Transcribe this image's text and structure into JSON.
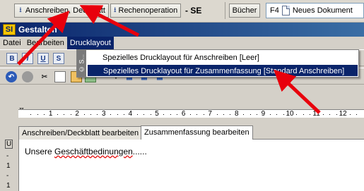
{
  "taskbar": {
    "btn_anschreiben": "Anschreiben, Deckblatt",
    "btn_rechenoperation": "Rechenoperation",
    "se_label": "- SE",
    "btn_buecher": "Bücher",
    "doc_hotkey": "F4",
    "doc_label": "Neues Dokument"
  },
  "window": {
    "logo": "SI",
    "title": "Gestalten"
  },
  "menubar": {
    "datei": "Datei",
    "bearbeiten": "Bearbeiten",
    "drucklayout": "Drucklayout"
  },
  "format_buttons": [
    "B",
    "I",
    "U",
    "S"
  ],
  "dropdown": {
    "side_label": "© S...",
    "items": [
      "Spezielles Drucklayout für Anschreiben [Leer]",
      "Spezielles Drucklayout für Zusammenfassung [Standard Anschreiben]"
    ],
    "selected_index": 1
  },
  "ruler": {
    "numbers": [
      "1",
      "2",
      "3",
      "4",
      "5",
      "6",
      "7",
      "8",
      "9",
      "10",
      "11",
      "12"
    ]
  },
  "tabs": [
    "Anschreiben/Deckblatt bearbeiten",
    "Zusammenfassung bearbeiten"
  ],
  "active_tab": 1,
  "gutter_marks": [
    "U",
    "-",
    "1",
    "-",
    "1"
  ],
  "editor": {
    "text_main": "Unsere ",
    "text_misspelled": "Geschäftbedinungen",
    "text_tail": "......"
  },
  "colors": {
    "title_start": "#0a246a",
    "title_end": "#3a6ea5",
    "selection": "#0a246a",
    "arrow": "#e8000c"
  }
}
